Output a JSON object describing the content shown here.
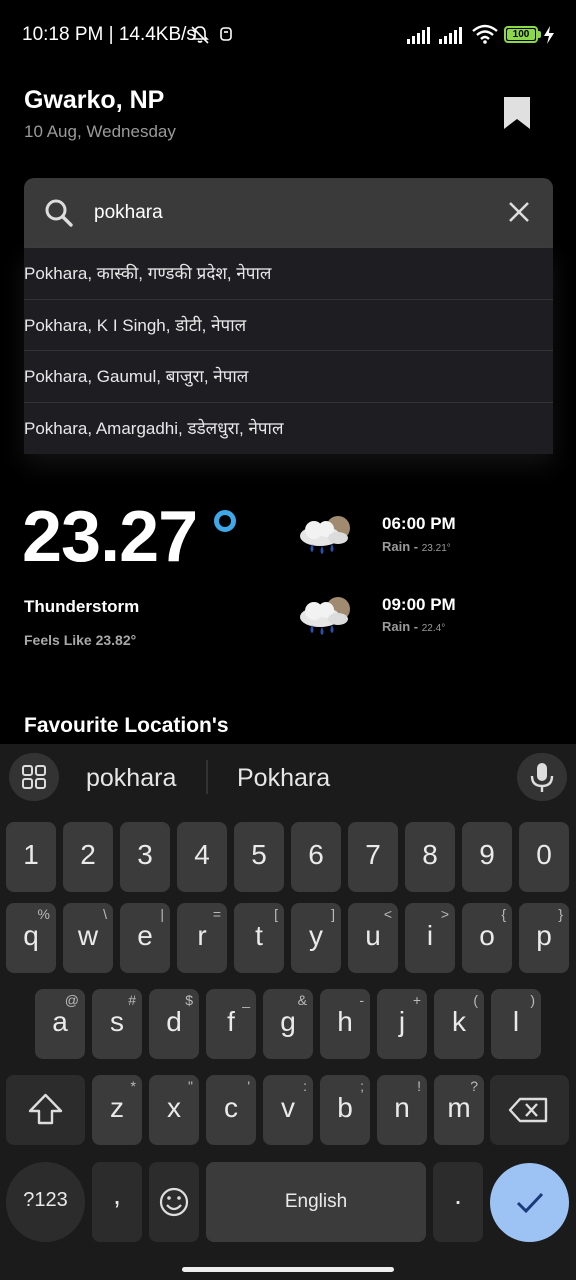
{
  "status_bar": {
    "time": "10:18 PM | 14.4KB/s",
    "battery": "100",
    "icons": [
      "bell-off-icon",
      "usb-icon",
      "signal-icon",
      "signal-icon",
      "wifi-icon",
      "battery-icon",
      "charging-icon"
    ]
  },
  "header": {
    "location": "Gwarko, NP",
    "date": "10 Aug, Wednesday",
    "bookmark_icon": "bookmark-icon"
  },
  "search": {
    "value": "pokhara",
    "suggestions": [
      "Pokhara, कास्की, गण्डकी प्रदेश, नेपाल",
      "Pokhara, K I Singh, डोटी, नेपाल",
      "Pokhara, Gaumul, बाजुरा, नेपाल",
      "Pokhara, Amargadhi, डडेलधुरा, नेपाल"
    ]
  },
  "weather": {
    "temperature": "23.27",
    "condition": "Thunderstorm",
    "feels_like": "Feels Like 23.82°",
    "forecast": [
      {
        "time": "06:00 PM",
        "label": "Rain - ",
        "temp": "23.21°"
      },
      {
        "time": "09:00 PM",
        "label": "Rain - ",
        "temp": "22.4°"
      }
    ]
  },
  "favourites": {
    "title": "Favourite Location's"
  },
  "keyboard": {
    "suggestions": [
      "pokhara",
      "Pokhara"
    ],
    "row1": [
      "1",
      "2",
      "3",
      "4",
      "5",
      "6",
      "7",
      "8",
      "9",
      "0"
    ],
    "row2": [
      [
        "q",
        "%"
      ],
      [
        "w",
        "\\"
      ],
      [
        "e",
        "|"
      ],
      [
        "r",
        "="
      ],
      [
        "t",
        "["
      ],
      [
        "y",
        "]"
      ],
      [
        "u",
        "<"
      ],
      [
        "i",
        ">"
      ],
      [
        "o",
        "{"
      ],
      [
        "p",
        "}"
      ]
    ],
    "row3": [
      [
        "a",
        "@"
      ],
      [
        "s",
        "#"
      ],
      [
        "d",
        "$"
      ],
      [
        "f",
        "_"
      ],
      [
        "g",
        "&"
      ],
      [
        "h",
        "-"
      ],
      [
        "j",
        "+"
      ],
      [
        "k",
        "("
      ],
      [
        "l",
        ")"
      ]
    ],
    "row4": [
      [
        "z",
        "*"
      ],
      [
        "x",
        "\""
      ],
      [
        "c",
        "'"
      ],
      [
        "v",
        ":"
      ],
      [
        "b",
        ";"
      ],
      [
        "n",
        "!"
      ],
      [
        "m",
        "?"
      ]
    ],
    "sym_label": "?123",
    "comma": ",",
    "space_label": "English",
    "period": "."
  }
}
